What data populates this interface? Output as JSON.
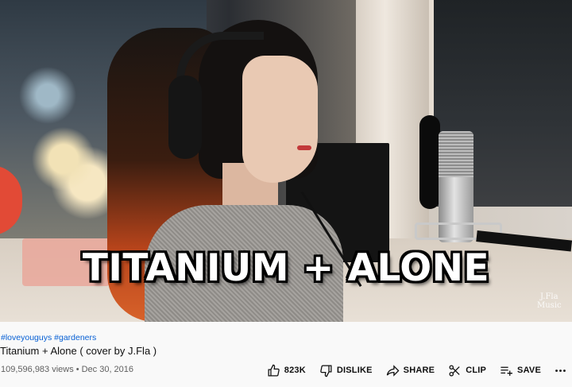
{
  "video": {
    "overlay_title": "TITANIUM + ALONE",
    "watermark_line1": "J.Fla",
    "watermark_line2": "Music"
  },
  "info": {
    "hashtags": [
      "#loveyouguys",
      "#gardeners"
    ],
    "title": "Titanium + Alone ( cover by J.Fla )",
    "views": "109,596,983 views",
    "separator": "•",
    "date": "Dec 30, 2016"
  },
  "actions": {
    "like_count": "823K",
    "dislike_label": "DISLIKE",
    "share_label": "SHARE",
    "clip_label": "CLIP",
    "save_label": "SAVE"
  },
  "icons": {
    "like": "thumbs-up-icon",
    "dislike": "thumbs-down-icon",
    "share": "share-arrow-icon",
    "clip": "scissors-icon",
    "save": "playlist-add-icon",
    "more": "more-horizontal-icon"
  },
  "colors": {
    "link": "#065fd4",
    "text": "#0f0f0f",
    "secondary_text": "#606060",
    "background": "#f9f9f9"
  }
}
